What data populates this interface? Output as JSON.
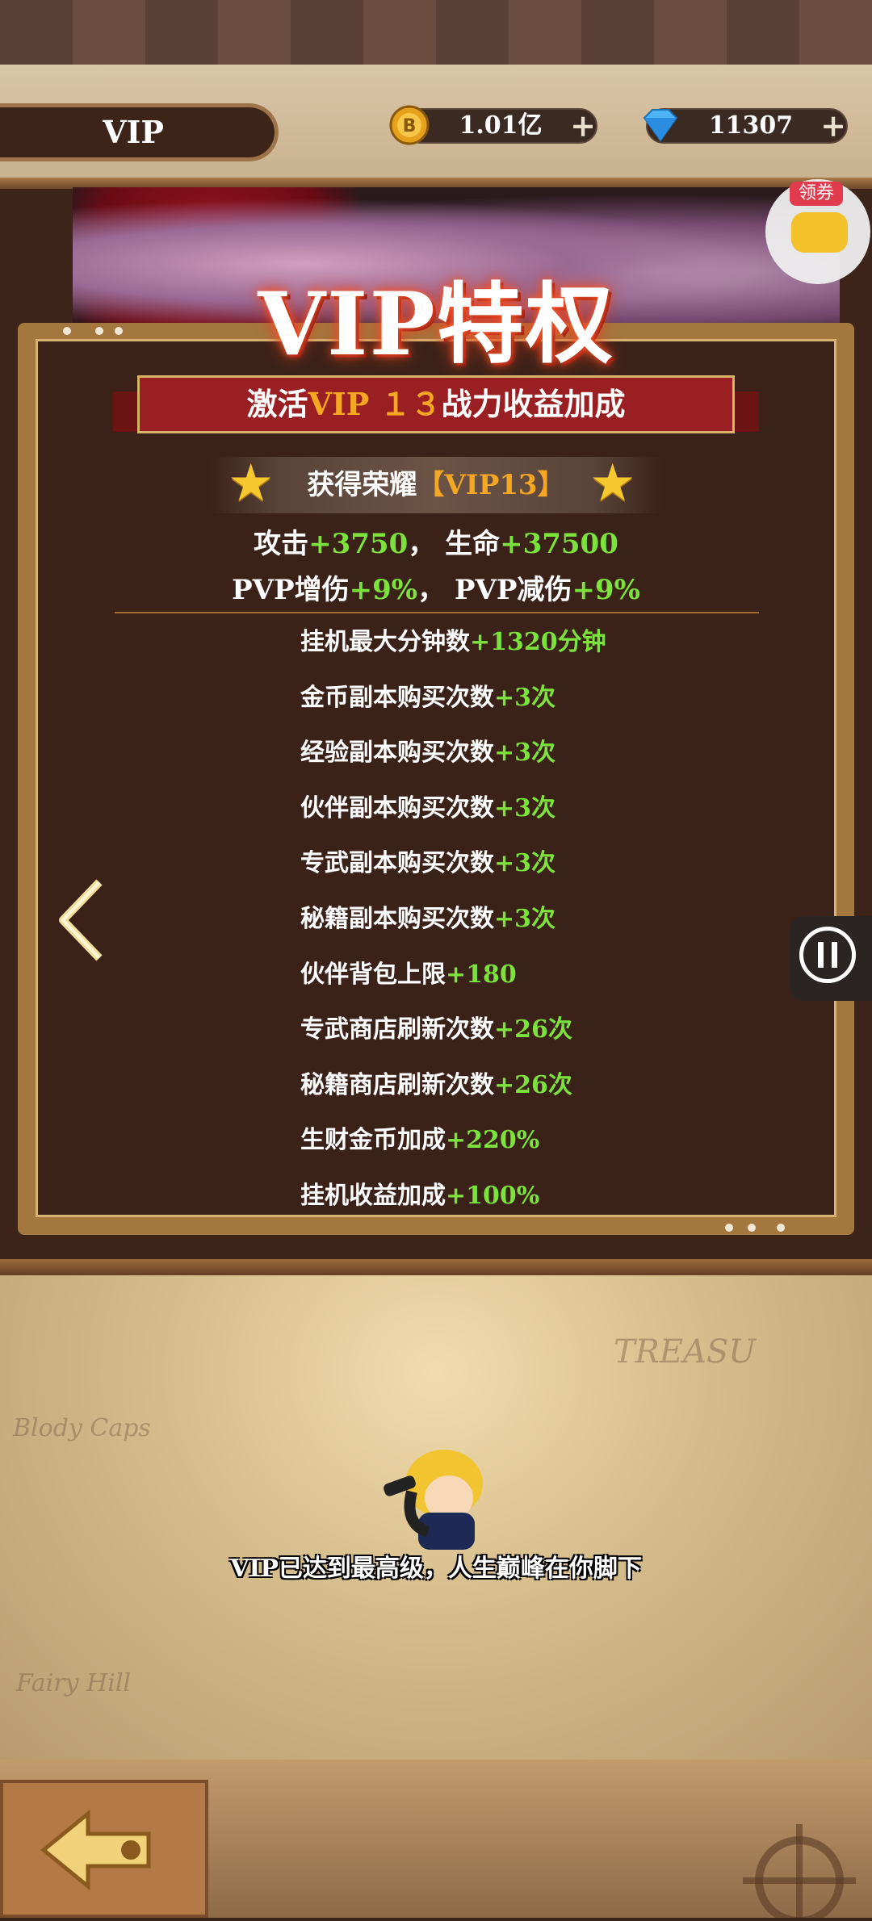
{
  "header": {
    "tab_label": "VIP",
    "gold_value": "1.01亿",
    "gem_value": "11307",
    "plus": "+"
  },
  "banner": {
    "title": "VIP特权",
    "coupon_label": "领券"
  },
  "panel": {
    "ribbon_prefix": "激活",
    "ribbon_vip": "VIP",
    "ribbon_num": "１３",
    "ribbon_suffix": "战力收益加成",
    "honor_prefix": "获得荣耀",
    "honor_value": "【VIP13】",
    "stats_line1": {
      "a_label": "攻击",
      "a_val": "+3750",
      "sep": "，",
      "b_label": "生命",
      "b_val": "+37500"
    },
    "stats_line2": {
      "a_label": "PVP增伤",
      "a_val": "+9%",
      "sep": "，",
      "b_label": "PVP减伤",
      "b_val": "+9%"
    },
    "bonuses": [
      {
        "label": "挂机最大分钟数",
        "value": "+1320分钟"
      },
      {
        "label": "金币副本购买次数",
        "value": "+3次"
      },
      {
        "label": "经验副本购买次数",
        "value": "+3次"
      },
      {
        "label": "伙伴副本购买次数",
        "value": "+3次"
      },
      {
        "label": "专武副本购买次数",
        "value": "+3次"
      },
      {
        "label": "秘籍副本购买次数",
        "value": "+3次"
      },
      {
        "label": "伙伴背包上限",
        "value": "+180"
      },
      {
        "label": "专武商店刷新次数",
        "value": "+26次"
      },
      {
        "label": "秘籍商店刷新次数",
        "value": "+26次"
      },
      {
        "label": "生财金币加成",
        "value": "+220%"
      },
      {
        "label": "挂机收益加成",
        "value": "+100%"
      }
    ]
  },
  "map": {
    "message": "VIP已达到最高级，人生巅峰在你脚下",
    "deco_treasure": "TREASU",
    "deco_blody": "Blody Caps",
    "deco_fairy": "Fairy Hill"
  },
  "colors": {
    "green": "#7ce23c",
    "gold": "#f5a623",
    "ribbon_red": "#9a1f22"
  },
  "icons": {
    "gold": "gold-coin-icon",
    "gem": "diamond-icon",
    "star": "star-icon",
    "prev": "chevron-left-icon",
    "pause": "pause-icon",
    "back": "anchor-icon"
  }
}
